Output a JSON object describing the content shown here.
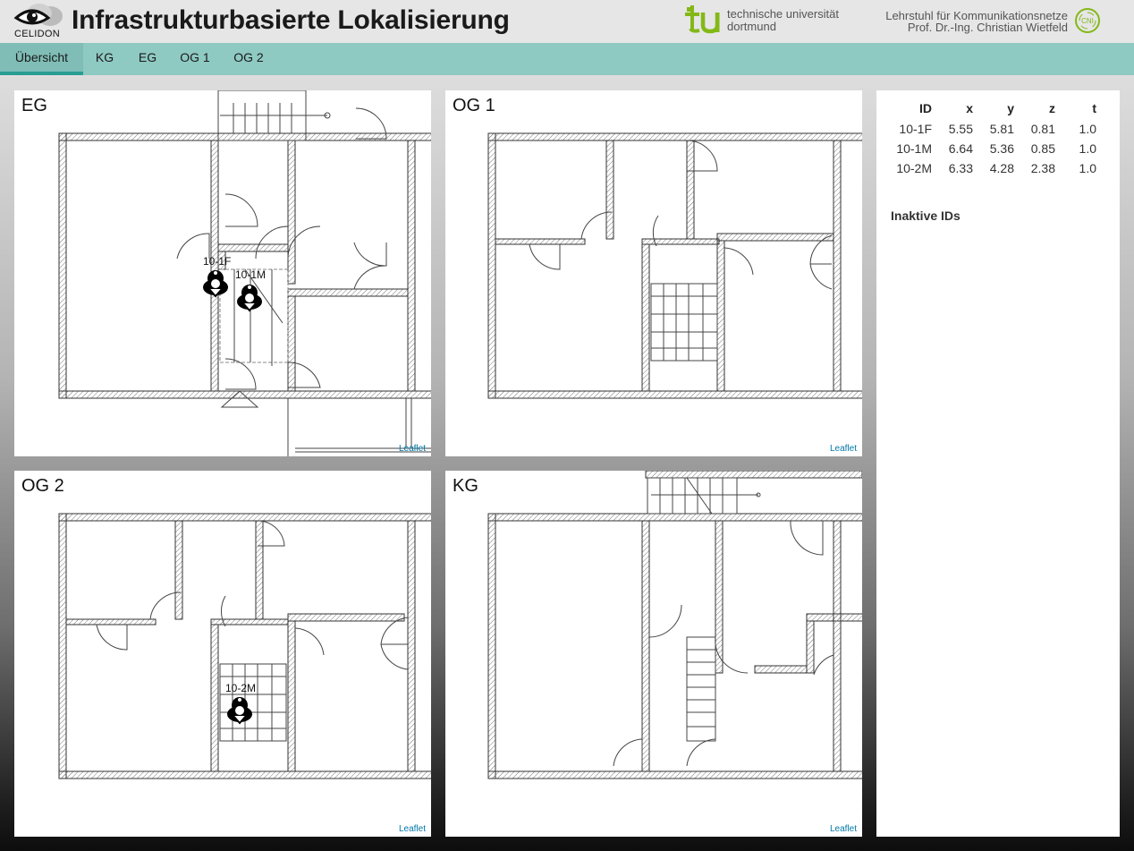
{
  "header": {
    "logo_text": "CELIDON",
    "title": "Infrastrukturbasierte Lokalisierung",
    "university_line1": "technische universität",
    "university_line2": "dortmund",
    "chair_line1": "Lehrstuhl für Kommunikationsnetze",
    "chair_line2": "Prof. Dr.-Ing. Christian Wietfeld",
    "cni_text": "CNI"
  },
  "nav": {
    "tabs": [
      {
        "label": "Übersicht",
        "active": true
      },
      {
        "label": "KG",
        "active": false
      },
      {
        "label": "EG",
        "active": false
      },
      {
        "label": "OG 1",
        "active": false
      },
      {
        "label": "OG 2",
        "active": false
      }
    ]
  },
  "maps": {
    "eg": {
      "title": "EG",
      "attribution": "Leaflet",
      "tags": [
        "10-1F",
        "10-1M"
      ]
    },
    "og1": {
      "title": "OG 1",
      "attribution": "Leaflet",
      "tags": []
    },
    "og2": {
      "title": "OG 2",
      "attribution": "Leaflet",
      "tags": [
        "10-2M"
      ]
    },
    "kg": {
      "title": "KG",
      "attribution": "Leaflet",
      "tags": []
    }
  },
  "sidebar": {
    "columns": [
      "ID",
      "x",
      "y",
      "z",
      "t"
    ],
    "rows": [
      [
        "10-1F",
        "5.55",
        "5.81",
        "0.81",
        "1.0"
      ],
      [
        "10-1M",
        "6.64",
        "5.36",
        "0.85",
        "1.0"
      ],
      [
        "10-2M",
        "6.33",
        "4.28",
        "2.38",
        "1.0"
      ]
    ],
    "inactive_title": "Inaktive IDs"
  },
  "colors": {
    "nav_bg": "#8ec9c2",
    "nav_active": "#2a9d92",
    "tu_green": "#84b817",
    "link": "#0078a8"
  }
}
